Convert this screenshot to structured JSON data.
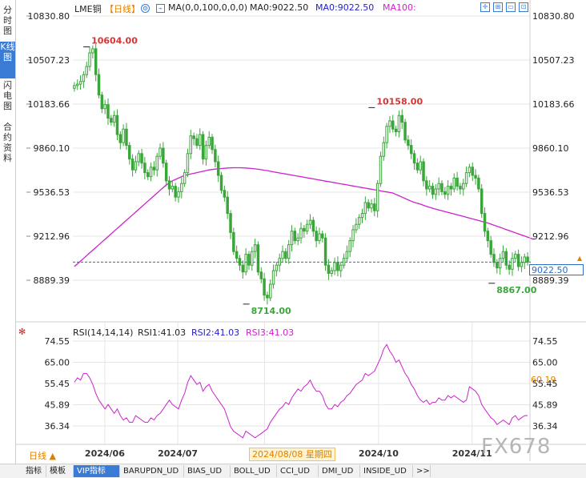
{
  "sidebar": {
    "tabs": [
      {
        "label": "分时图",
        "active": false
      },
      {
        "label": "K线图",
        "active": true
      },
      {
        "label": "闪电图",
        "active": false
      },
      {
        "label": "合约资料",
        "active": false
      }
    ]
  },
  "header": {
    "symbol": "LME铜",
    "period": "【日线】",
    "ma_label": "MA(0,0,100,0,0,0)",
    "ma0": "MA0:9022.50",
    "ma0_b": "MA0:9022.50",
    "ma100": "MA100:",
    "colors": {
      "symbol": "#222222",
      "period": "#e08000",
      "ma0": "#222222",
      "ma0_b": "#2222cc",
      "ma100": "#cc22cc"
    }
  },
  "rsi_header": {
    "name": "RSI(14,14,14)",
    "rsi1": "RSI1:41.03",
    "rsi2": "RSI2:41.03",
    "rsi3": "RSI3:41.03"
  },
  "current_price_label": "9022.50",
  "rsi_current_label": "60.19",
  "crosshair_date_label": "2024/08/08 星期四",
  "watermark": "FX678",
  "period_button": "日线 ▲",
  "toolbar": {
    "items": [
      "指标",
      "模板",
      "VIP指标",
      "BARUPDN_UD",
      "BIAS_UD",
      "BOLL_UD",
      "CCI_UD",
      "DMI_UD",
      "INSIDE_UD",
      ">>"
    ],
    "active_index": 2
  },
  "colors": {
    "up": "#3aa63a",
    "down": "#3aa63a",
    "ma": "#cc22cc",
    "rsi": "#cc22cc",
    "price_line": "#2a6fc7",
    "annot_high": "#e03030",
    "annot_low": "#3aa63a",
    "grid": "#e6e6e6"
  },
  "chart_data": [
    {
      "type": "candlestick",
      "title": "LME铜 日线",
      "y_ticks": [
        10830.8,
        10507.23,
        10183.66,
        9860.1,
        9536.53,
        9212.96,
        8889.39
      ],
      "x_ticks": [
        "2024/06",
        "2024/07",
        "202",
        "2024/10",
        "2024/11"
      ],
      "ylim": [
        8680,
        10830.8
      ],
      "annotations": [
        {
          "label": "10604.00",
          "value": 10604.0,
          "kind": "high"
        },
        {
          "label": "10158.00",
          "value": 10158.0,
          "kind": "high"
        },
        {
          "label": "8714.00",
          "value": 8714.0,
          "kind": "low"
        },
        {
          "label": "8867.00",
          "value": 8867.0,
          "kind": "low"
        }
      ],
      "last_price": 9022.5,
      "close_series": [
        10320,
        10330,
        10350,
        10400,
        10460,
        10560,
        10590,
        10400,
        10250,
        10150,
        10180,
        10080,
        10050,
        10100,
        9960,
        9900,
        10000,
        9880,
        9780,
        9700,
        9760,
        9820,
        9750,
        9680,
        9650,
        9720,
        9700,
        9800,
        9860,
        9750,
        9620,
        9560,
        9580,
        9500,
        9540,
        9600,
        9680,
        9820,
        9950,
        9930,
        9880,
        9960,
        9780,
        9880,
        9940,
        9850,
        9760,
        9660,
        9550,
        9500,
        9380,
        9240,
        9100,
        9050,
        9000,
        8950,
        9080,
        9000,
        9100,
        9150,
        8950,
        8900,
        8780,
        8760,
        8860,
        8960,
        9000,
        9050,
        9100,
        9050,
        9150,
        9250,
        9180,
        9200,
        9270,
        9250,
        9300,
        9330,
        9250,
        9180,
        9230,
        9200,
        9000,
        8940,
        8960,
        9020,
        8960,
        9000,
        9050,
        9100,
        9180,
        9260,
        9300,
        9350,
        9380,
        9460,
        9420,
        9450,
        9400,
        9600,
        9800,
        9900,
        10020,
        10060,
        10000,
        9980,
        10100,
        10050,
        9920,
        9880,
        9820,
        9750,
        9700,
        9760,
        9620,
        9560,
        9580,
        9520,
        9560,
        9600,
        9540,
        9520,
        9580,
        9560,
        9640,
        9580,
        9560,
        9600,
        9680,
        9720,
        9660,
        9640,
        9560,
        9380,
        9250,
        9180,
        9080,
        9020,
        8980,
        9050,
        9100,
        9000,
        8970,
        9050,
        9080,
        8990,
        9020,
        9060,
        9022.5
      ],
      "ma100_series": [
        8990,
        9010,
        9030,
        9050,
        9070,
        9090,
        9110,
        9130,
        9150,
        9170,
        9190,
        9210,
        9230,
        9250,
        9270,
        9290,
        9310,
        9330,
        9350,
        9370,
        9390,
        9410,
        9430,
        9450,
        9470,
        9490,
        9510,
        9530,
        9550,
        9570,
        9590,
        9605,
        9620,
        9630,
        9640,
        9650,
        9660,
        9665,
        9670,
        9675,
        9680,
        9685,
        9690,
        9695,
        9700,
        9703,
        9706,
        9708,
        9710,
        9712,
        9714,
        9715,
        9716,
        9716,
        9716,
        9715,
        9714,
        9712,
        9710,
        9708,
        9705,
        9702,
        9698,
        9695,
        9690,
        9686,
        9682,
        9678,
        9674,
        9670,
        9666,
        9662,
        9658,
        9654,
        9650,
        9646,
        9642,
        9638,
        9634,
        9630,
        9626,
        9622,
        9618,
        9614,
        9610,
        9606,
        9602,
        9598,
        9594,
        9590,
        9586,
        9582,
        9578,
        9574,
        9570,
        9566,
        9562,
        9558,
        9554,
        9550,
        9546,
        9542,
        9538,
        9534,
        9530,
        9520,
        9510,
        9500,
        9490,
        9480,
        9470,
        9462,
        9455,
        9448,
        9440,
        9432,
        9425,
        9418,
        9412,
        9406,
        9400,
        9394,
        9388,
        9382,
        9376,
        9370,
        9364,
        9358,
        9352,
        9346,
        9340,
        9334,
        9328,
        9322,
        9316,
        9310,
        9302,
        9294,
        9286,
        9278,
        9270,
        9262,
        9254,
        9246,
        9238,
        9230,
        9222,
        9214,
        9206,
        9198,
        9190
      ]
    },
    {
      "type": "line",
      "title": "RSI(14,14,14)",
      "y_ticks": [
        74.55,
        65.0,
        55.45,
        45.89,
        36.34
      ],
      "ylim": [
        29,
        80
      ],
      "current_label": "60.19",
      "series": [
        {
          "name": "RSI1",
          "values": [
            56,
            58,
            57,
            60,
            60,
            58,
            55,
            51,
            48,
            46,
            44,
            46,
            44,
            42,
            44,
            41,
            39,
            40,
            38,
            38,
            41,
            40,
            39,
            38,
            38,
            40,
            39,
            41,
            42,
            44,
            46,
            48,
            46,
            45,
            44,
            48,
            51,
            56,
            59,
            57,
            55,
            56,
            52,
            54,
            55,
            52,
            50,
            48,
            46,
            44,
            40,
            36,
            34,
            33,
            32,
            31,
            34,
            33,
            32,
            31,
            32,
            33,
            34,
            35,
            38,
            40,
            42,
            44,
            45,
            47,
            46,
            49,
            51,
            53,
            52,
            54,
            55,
            57,
            54,
            52,
            52,
            50,
            46,
            44,
            44,
            46,
            45,
            47,
            48,
            50,
            51,
            53,
            55,
            56,
            57,
            60,
            59,
            60,
            61,
            64,
            67,
            71,
            73,
            70,
            68,
            65,
            66,
            63,
            60,
            58,
            55,
            53,
            50,
            48,
            47,
            48,
            46,
            47,
            47,
            49,
            48,
            48,
            50,
            49,
            50,
            49,
            48,
            47,
            48,
            54,
            53,
            52,
            50,
            46,
            44,
            42,
            40,
            39,
            37,
            38,
            39,
            38,
            37,
            40,
            41,
            39,
            40,
            41,
            41.03
          ]
        }
      ]
    }
  ]
}
